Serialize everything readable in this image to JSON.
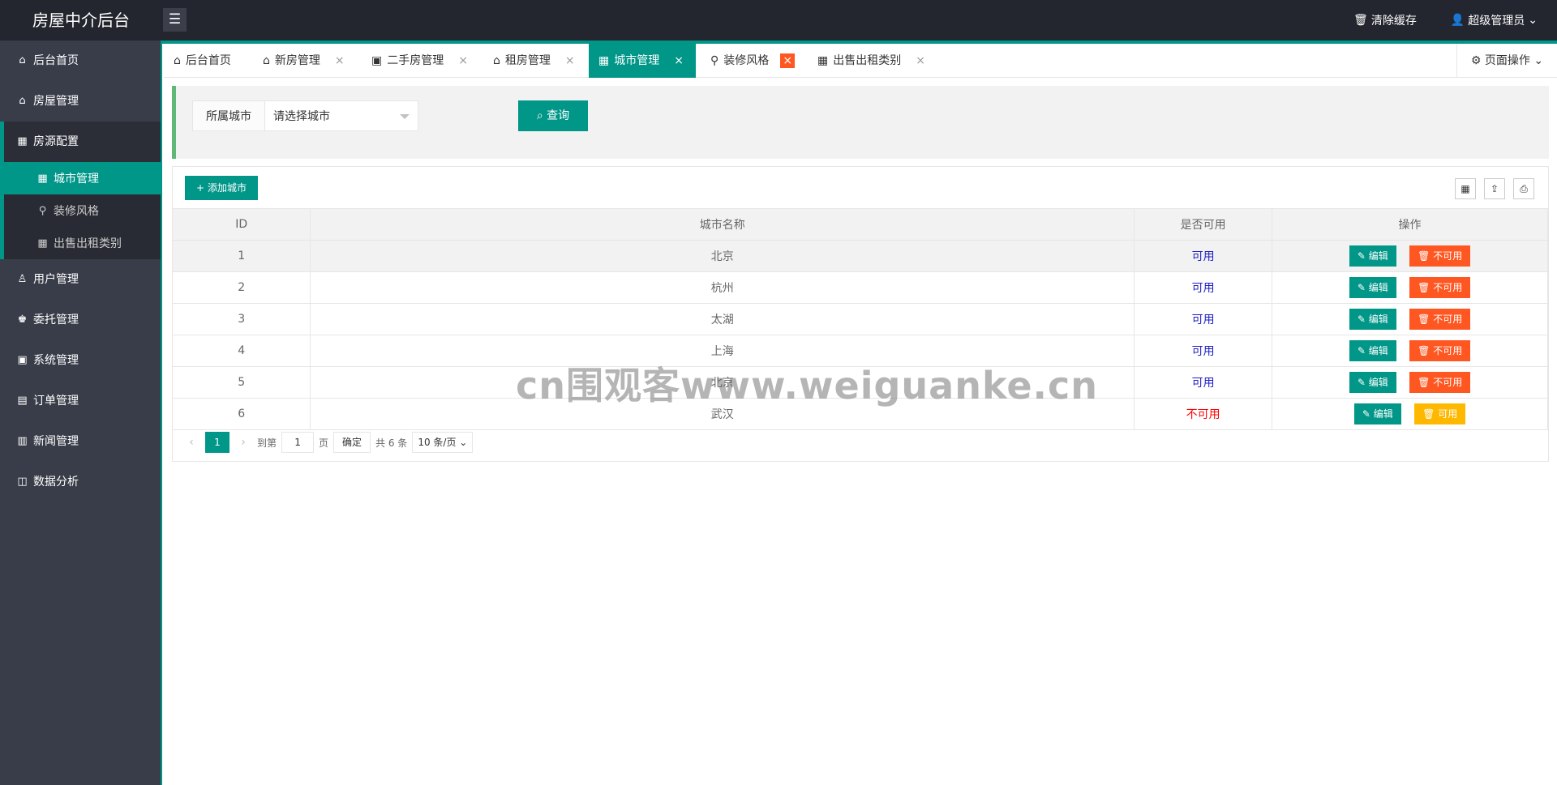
{
  "header": {
    "logo": "房屋中介后台",
    "menu_toggle": "☰",
    "clear_cache": "清除缓存",
    "user": "超级管理员"
  },
  "sidebar": {
    "items": [
      {
        "label": "后台首页",
        "icon": "home-icon"
      },
      {
        "label": "房屋管理",
        "icon": "house-icon"
      },
      {
        "label": "房源配置",
        "icon": "building-icon"
      },
      {
        "label": "用户管理",
        "icon": "user-icon"
      },
      {
        "label": "委托管理",
        "icon": "handshake-icon"
      },
      {
        "label": "系统管理",
        "icon": "system-icon"
      },
      {
        "label": "订单管理",
        "icon": "order-icon"
      },
      {
        "label": "新闻管理",
        "icon": "news-icon"
      },
      {
        "label": "数据分析",
        "icon": "chart-icon"
      }
    ],
    "sub_items": [
      {
        "label": "城市管理"
      },
      {
        "label": "装修风格"
      },
      {
        "label": "出售出租类别"
      }
    ]
  },
  "tabs": [
    {
      "label": "后台首页"
    },
    {
      "label": "新房管理"
    },
    {
      "label": "二手房管理"
    },
    {
      "label": "租房管理"
    },
    {
      "label": "城市管理"
    },
    {
      "label": "装修风格"
    },
    {
      "label": "出售出租类别"
    }
  ],
  "page_ops": "页面操作",
  "search": {
    "label": "所属城市",
    "placeholder": "请选择城市",
    "button": "查询"
  },
  "toolbar": {
    "add_button": "添加城市"
  },
  "table": {
    "headers": [
      "ID",
      "城市名称",
      "是否可用",
      "操作"
    ],
    "rows": [
      {
        "id": "1",
        "name": "北京",
        "status": "可用",
        "edit": "编辑",
        "toggle": "不可用"
      },
      {
        "id": "2",
        "name": "杭州",
        "status": "可用",
        "edit": "编辑",
        "toggle": "不可用"
      },
      {
        "id": "3",
        "name": "太湖",
        "status": "可用",
        "edit": "编辑",
        "toggle": "不可用"
      },
      {
        "id": "4",
        "name": "上海",
        "status": "可用",
        "edit": "编辑",
        "toggle": "不可用"
      },
      {
        "id": "5",
        "name": "北京",
        "status": "可用",
        "edit": "编辑",
        "toggle": "不可用"
      },
      {
        "id": "6",
        "name": "武汉",
        "status": "不可用",
        "edit": "编辑",
        "toggle": "可用"
      }
    ]
  },
  "pager": {
    "current": "1",
    "goto": "到第",
    "page_input": "1",
    "page_unit": "页",
    "confirm": "确定",
    "total": "共 6 条",
    "size": "10 条/页"
  },
  "watermark": "cn围观客www.weiguanke.cn"
}
